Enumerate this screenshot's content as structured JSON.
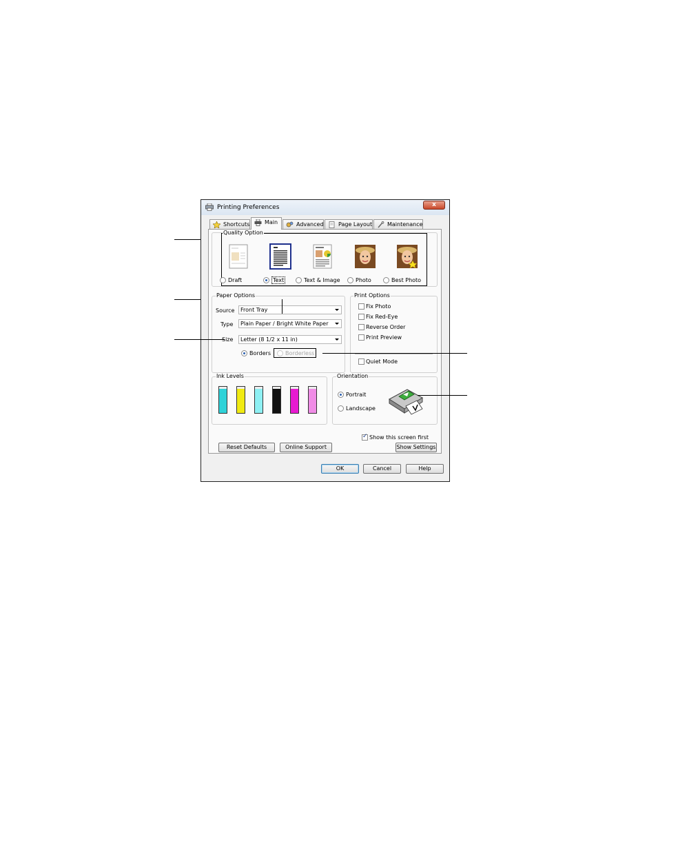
{
  "window": {
    "title": "Printing Preferences",
    "close_glyph": "x"
  },
  "tabs": [
    {
      "label": "Shortcuts",
      "icon": "star-icon"
    },
    {
      "label": "Main",
      "icon": "printer-icon"
    },
    {
      "label": "Advanced",
      "icon": "gears-icon"
    },
    {
      "label": "Page Layout",
      "icon": "page-icon"
    },
    {
      "label": "Maintenance",
      "icon": "wrench-icon"
    }
  ],
  "active_tab": "Main",
  "quality": {
    "legend": "Quality Option",
    "options": [
      {
        "label": "Draft",
        "selected": false
      },
      {
        "label": "Text",
        "selected": true
      },
      {
        "label": "Text & Image",
        "selected": false
      },
      {
        "label": "Photo",
        "selected": false
      },
      {
        "label": "Best Photo",
        "selected": false
      }
    ]
  },
  "paper": {
    "legend": "Paper Options",
    "source_label": "Source",
    "source_value": "Front Tray",
    "type_label": "Type",
    "type_value": "Plain Paper / Bright White Paper",
    "size_label": "Size",
    "size_value": "Letter (8 1/2 x 11 in)",
    "borders_label": "Borders",
    "borderless_label": "Borderless"
  },
  "print_options": {
    "legend": "Print Options",
    "items": [
      {
        "label": "Fix Photo",
        "checked": false
      },
      {
        "label": "Fix Red-Eye",
        "checked": false
      },
      {
        "label": "Reverse Order",
        "checked": false
      },
      {
        "label": "Print Preview",
        "checked": false
      }
    ],
    "quiet_mode": "Quiet Mode"
  },
  "ink": {
    "legend": "Ink Levels",
    "colors": [
      "#2fd2d8",
      "#f0ea12",
      "#8ef0f3",
      "#111111",
      "#e81ad1",
      "#f08ce6"
    ]
  },
  "orientation": {
    "legend": "Orientation",
    "portrait": "Portrait",
    "landscape": "Landscape"
  },
  "show_screen_first": "Show this screen first",
  "buttons": {
    "reset": "Reset Defaults",
    "online": "Online Support",
    "show_settings": "Show Settings",
    "ok": "OK",
    "cancel": "Cancel",
    "help": "Help"
  }
}
